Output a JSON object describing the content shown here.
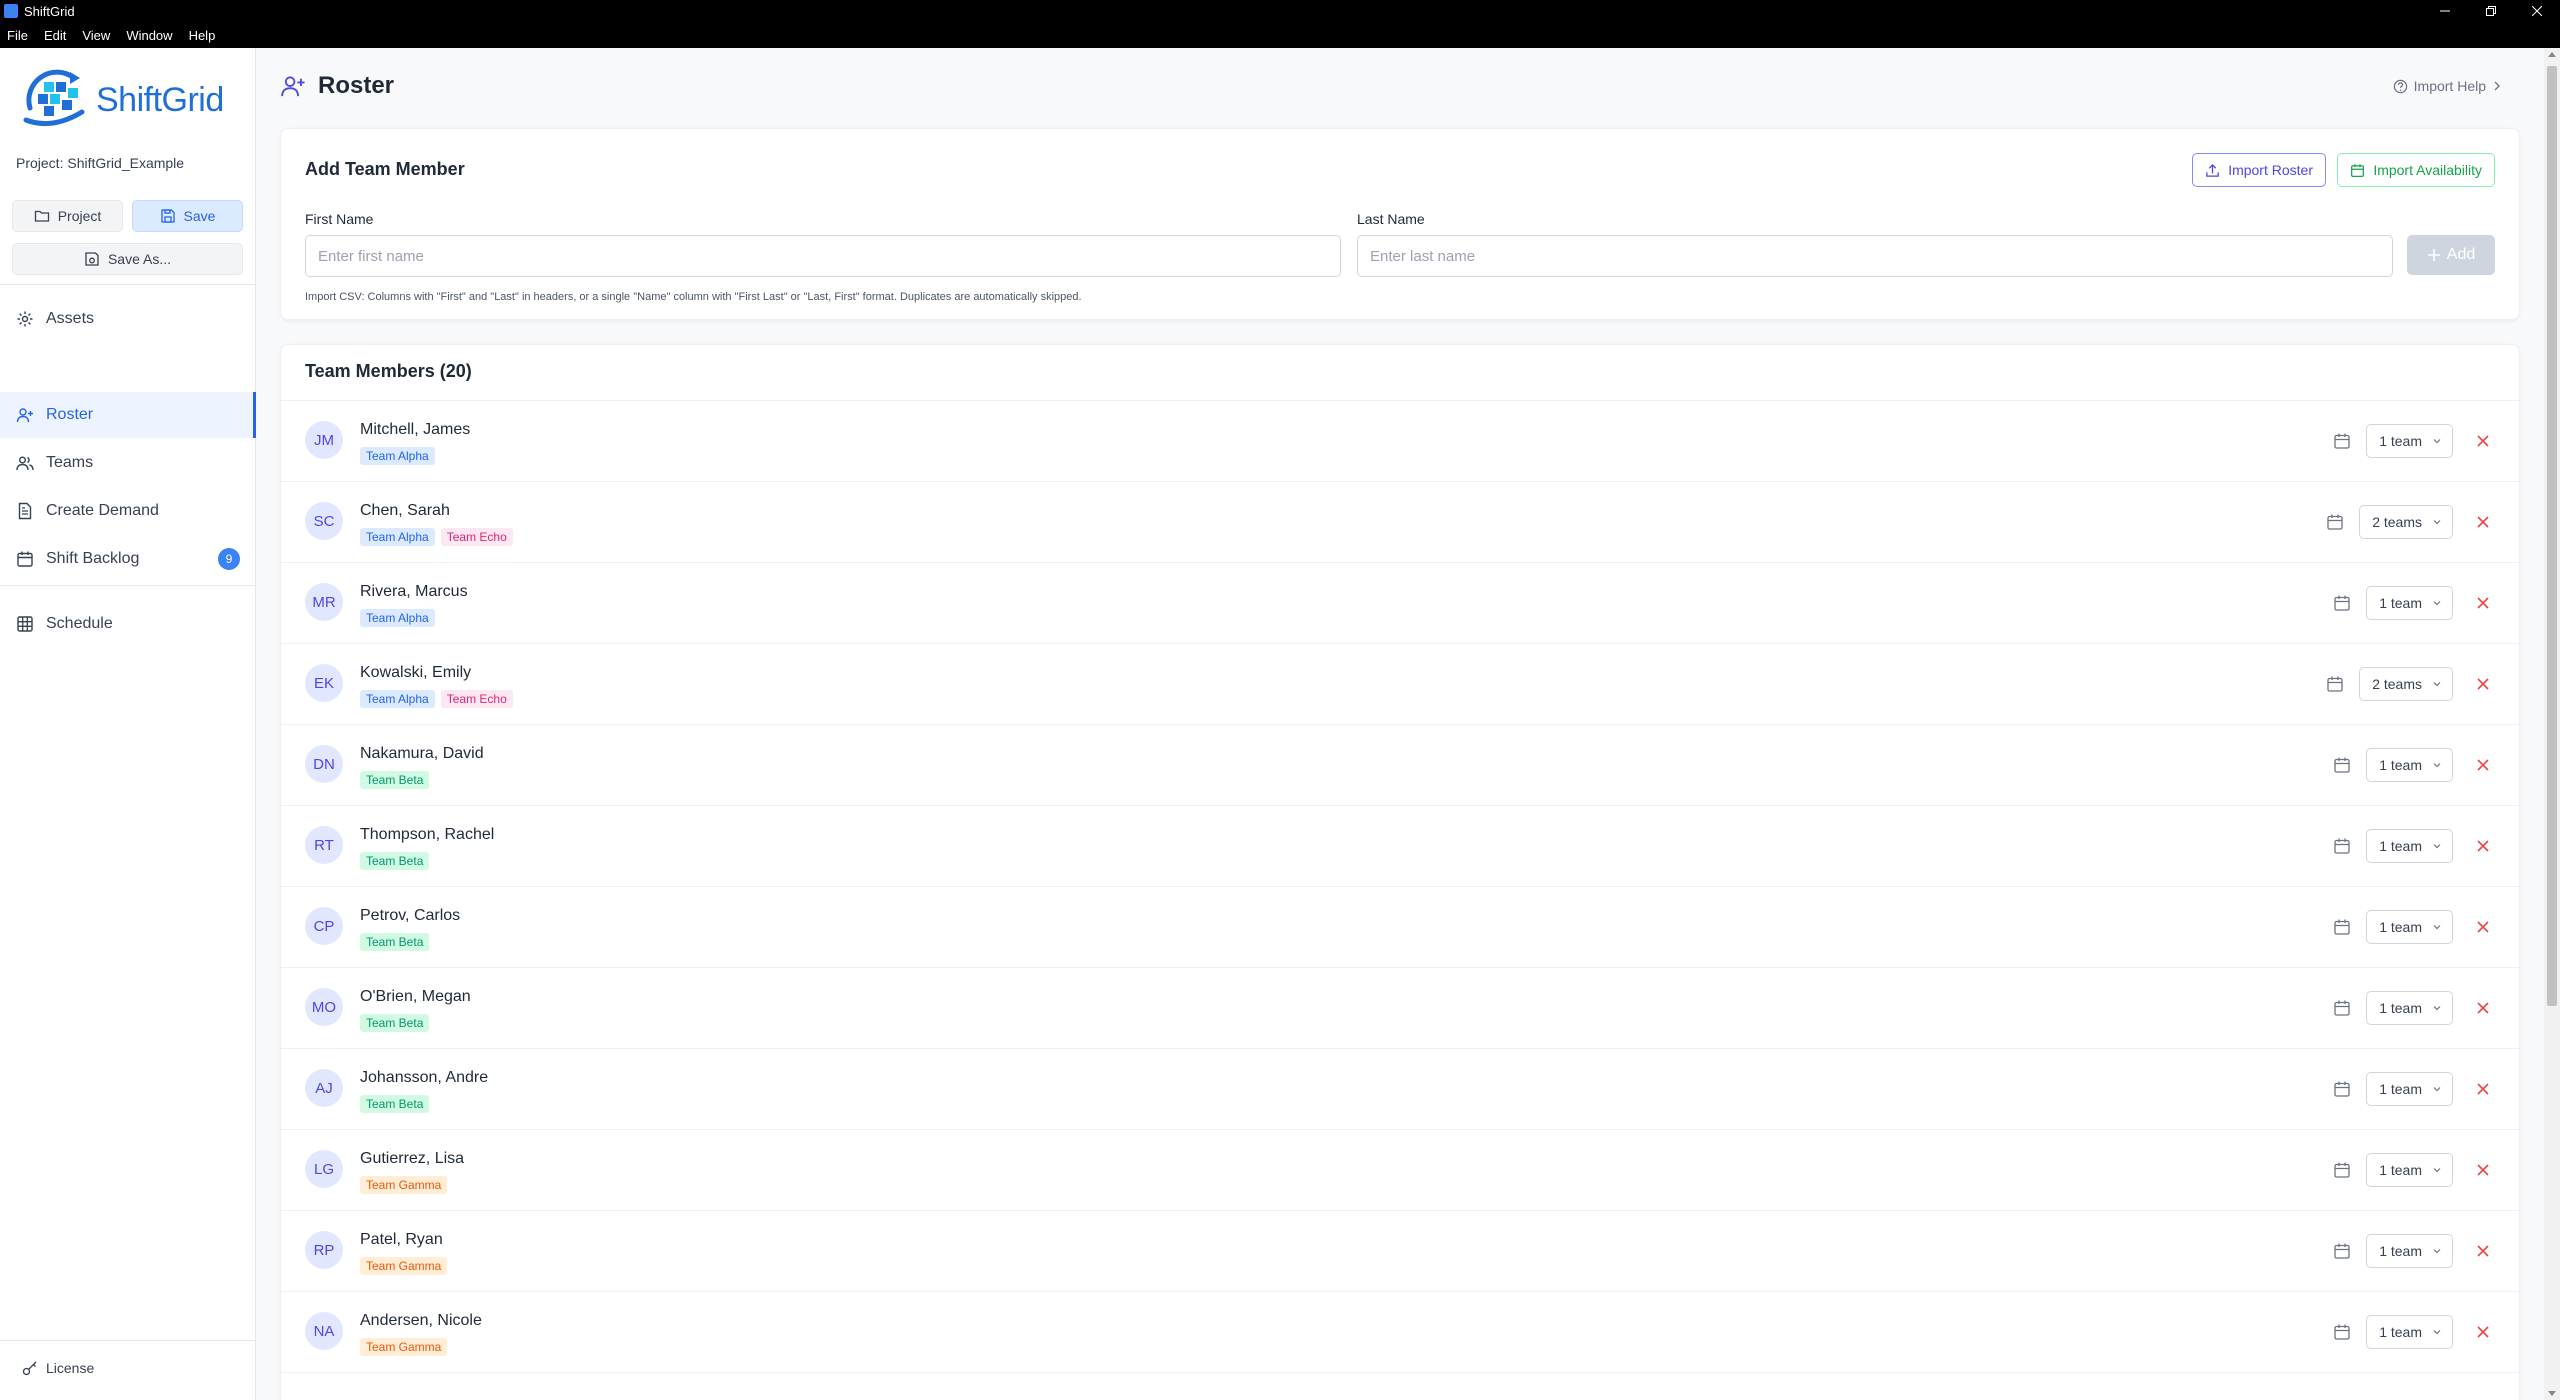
{
  "window": {
    "title": "ShiftGrid"
  },
  "menu": [
    "File",
    "Edit",
    "View",
    "Window",
    "Help"
  ],
  "sidebar": {
    "logo_text": "ShiftGrid",
    "project_label": "Project: ShiftGrid_Example",
    "project_button": "Project",
    "save_button": "Save",
    "save_as_button": "Save As...",
    "nav": [
      {
        "label": "Assets",
        "icon": "gear-icon"
      },
      {
        "label": "Roster",
        "icon": "user-plus-icon",
        "active": true
      },
      {
        "label": "Teams",
        "icon": "users-icon"
      },
      {
        "label": "Create Demand",
        "icon": "document-icon"
      },
      {
        "label": "Shift Backlog",
        "icon": "calendar-icon",
        "badge": "9"
      },
      {
        "label": "Schedule",
        "icon": "grid-icon"
      }
    ],
    "license": "License"
  },
  "header": {
    "title": "Roster",
    "import_help": "Import Help"
  },
  "add_member": {
    "title": "Add Team Member",
    "import_roster": "Import Roster",
    "import_availability": "Import Availability",
    "first_name_label": "First Name",
    "first_name_placeholder": "Enter first name",
    "last_name_label": "Last Name",
    "last_name_placeholder": "Enter last name",
    "add_button": "Add",
    "hint": "Import CSV: Columns with \"First\" and \"Last\" in headers, or a single \"Name\" column with \"First Last\" or \"Last, First\" format. Duplicates are automatically skipped."
  },
  "members": {
    "title": "Team Members (20)",
    "rows": [
      {
        "initials": "JM",
        "name": "Mitchell, James",
        "tags": [
          "Team Alpha"
        ],
        "teams": "1 team"
      },
      {
        "initials": "SC",
        "name": "Chen, Sarah",
        "tags": [
          "Team Alpha",
          "Team Echo"
        ],
        "teams": "2 teams"
      },
      {
        "initials": "MR",
        "name": "Rivera, Marcus",
        "tags": [
          "Team Alpha"
        ],
        "teams": "1 team"
      },
      {
        "initials": "EK",
        "name": "Kowalski, Emily",
        "tags": [
          "Team Alpha",
          "Team Echo"
        ],
        "teams": "2 teams"
      },
      {
        "initials": "DN",
        "name": "Nakamura, David",
        "tags": [
          "Team Beta"
        ],
        "teams": "1 team"
      },
      {
        "initials": "RT",
        "name": "Thompson, Rachel",
        "tags": [
          "Team Beta"
        ],
        "teams": "1 team"
      },
      {
        "initials": "CP",
        "name": "Petrov, Carlos",
        "tags": [
          "Team Beta"
        ],
        "teams": "1 team"
      },
      {
        "initials": "MO",
        "name": "O'Brien, Megan",
        "tags": [
          "Team Beta"
        ],
        "teams": "1 team"
      },
      {
        "initials": "AJ",
        "name": "Johansson, Andre",
        "tags": [
          "Team Beta"
        ],
        "teams": "1 team"
      },
      {
        "initials": "LG",
        "name": "Gutierrez, Lisa",
        "tags": [
          "Team Gamma"
        ],
        "teams": "1 team"
      },
      {
        "initials": "RP",
        "name": "Patel, Ryan",
        "tags": [
          "Team Gamma"
        ],
        "teams": "1 team"
      },
      {
        "initials": "NA",
        "name": "Andersen, Nicole",
        "tags": [
          "Team Gamma"
        ],
        "teams": "1 team"
      }
    ]
  },
  "tag_colors": {
    "Team Alpha": {
      "bg": "#dbeafe",
      "fg": "#2563eb"
    },
    "Team Echo": {
      "bg": "#fce7f3",
      "fg": "#db2777"
    },
    "Team Beta": {
      "bg": "#d1fae5",
      "fg": "#059669"
    },
    "Team Gamma": {
      "bg": "#ffedd5",
      "fg": "#ea580c"
    }
  }
}
